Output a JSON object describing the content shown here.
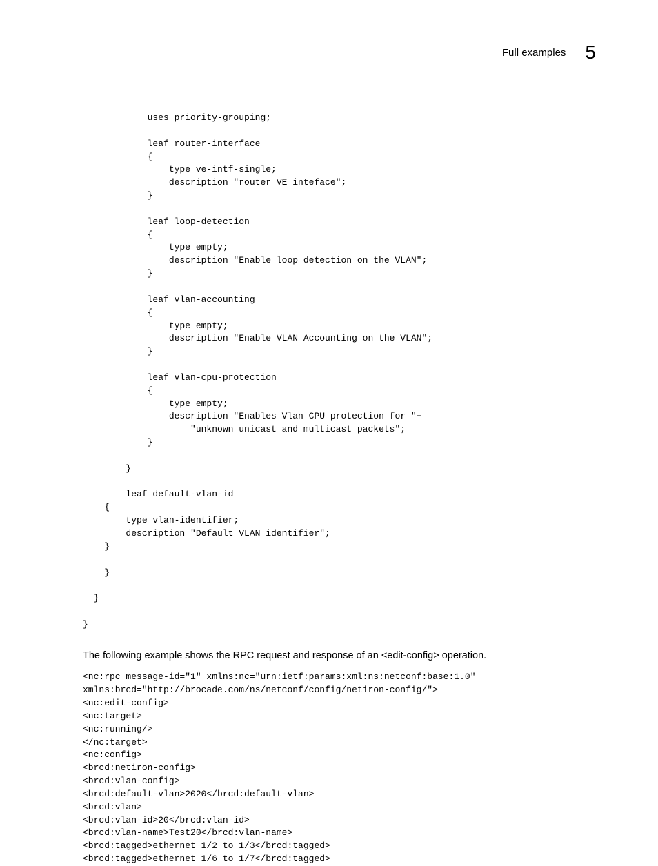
{
  "header": {
    "title": "Full examples",
    "chapter": "5"
  },
  "code1": "            uses priority-grouping;\n\n            leaf router-interface\n            {\n                type ve-intf-single;\n                description \"router VE inteface\";\n            }\n\n            leaf loop-detection\n            {\n                type empty;\n                description \"Enable loop detection on the VLAN\";\n            }\n\n            leaf vlan-accounting\n            {\n                type empty;\n                description \"Enable VLAN Accounting on the VLAN\";\n            }\n\n            leaf vlan-cpu-protection\n            {\n                type empty;\n                description \"Enables Vlan CPU protection for \"+\n                    \"unknown unicast and multicast packets\";\n            }\n\n        }\n\n        leaf default-vlan-id\n    {\n        type vlan-identifier;\n        description \"Default VLAN identifier\";\n    }\n\n    }\n\n  }\n\n}",
  "paragraph": "The following example shows the RPC request and response of an <edit-config> operation.",
  "code2": "<nc:rpc message-id=\"1\" xmlns:nc=\"urn:ietf:params:xml:ns:netconf:base:1.0\"\nxmlns:brcd=\"http://brocade.com/ns/netconf/config/netiron-config/\">\n<nc:edit-config>\n<nc:target>\n<nc:running/>\n</nc:target>\n<nc:config>\n<brcd:netiron-config>\n<brcd:vlan-config>\n<brcd:default-vlan>2020</brcd:default-vlan>\n<brcd:vlan>\n<brcd:vlan-id>20</brcd:vlan-id>\n<brcd:vlan-name>Test20</brcd:vlan-name>\n<brcd:tagged>ethernet 1/2 to 1/3</brcd:tagged>\n<brcd:tagged>ethernet 1/6 to 1/7</brcd:tagged>"
}
